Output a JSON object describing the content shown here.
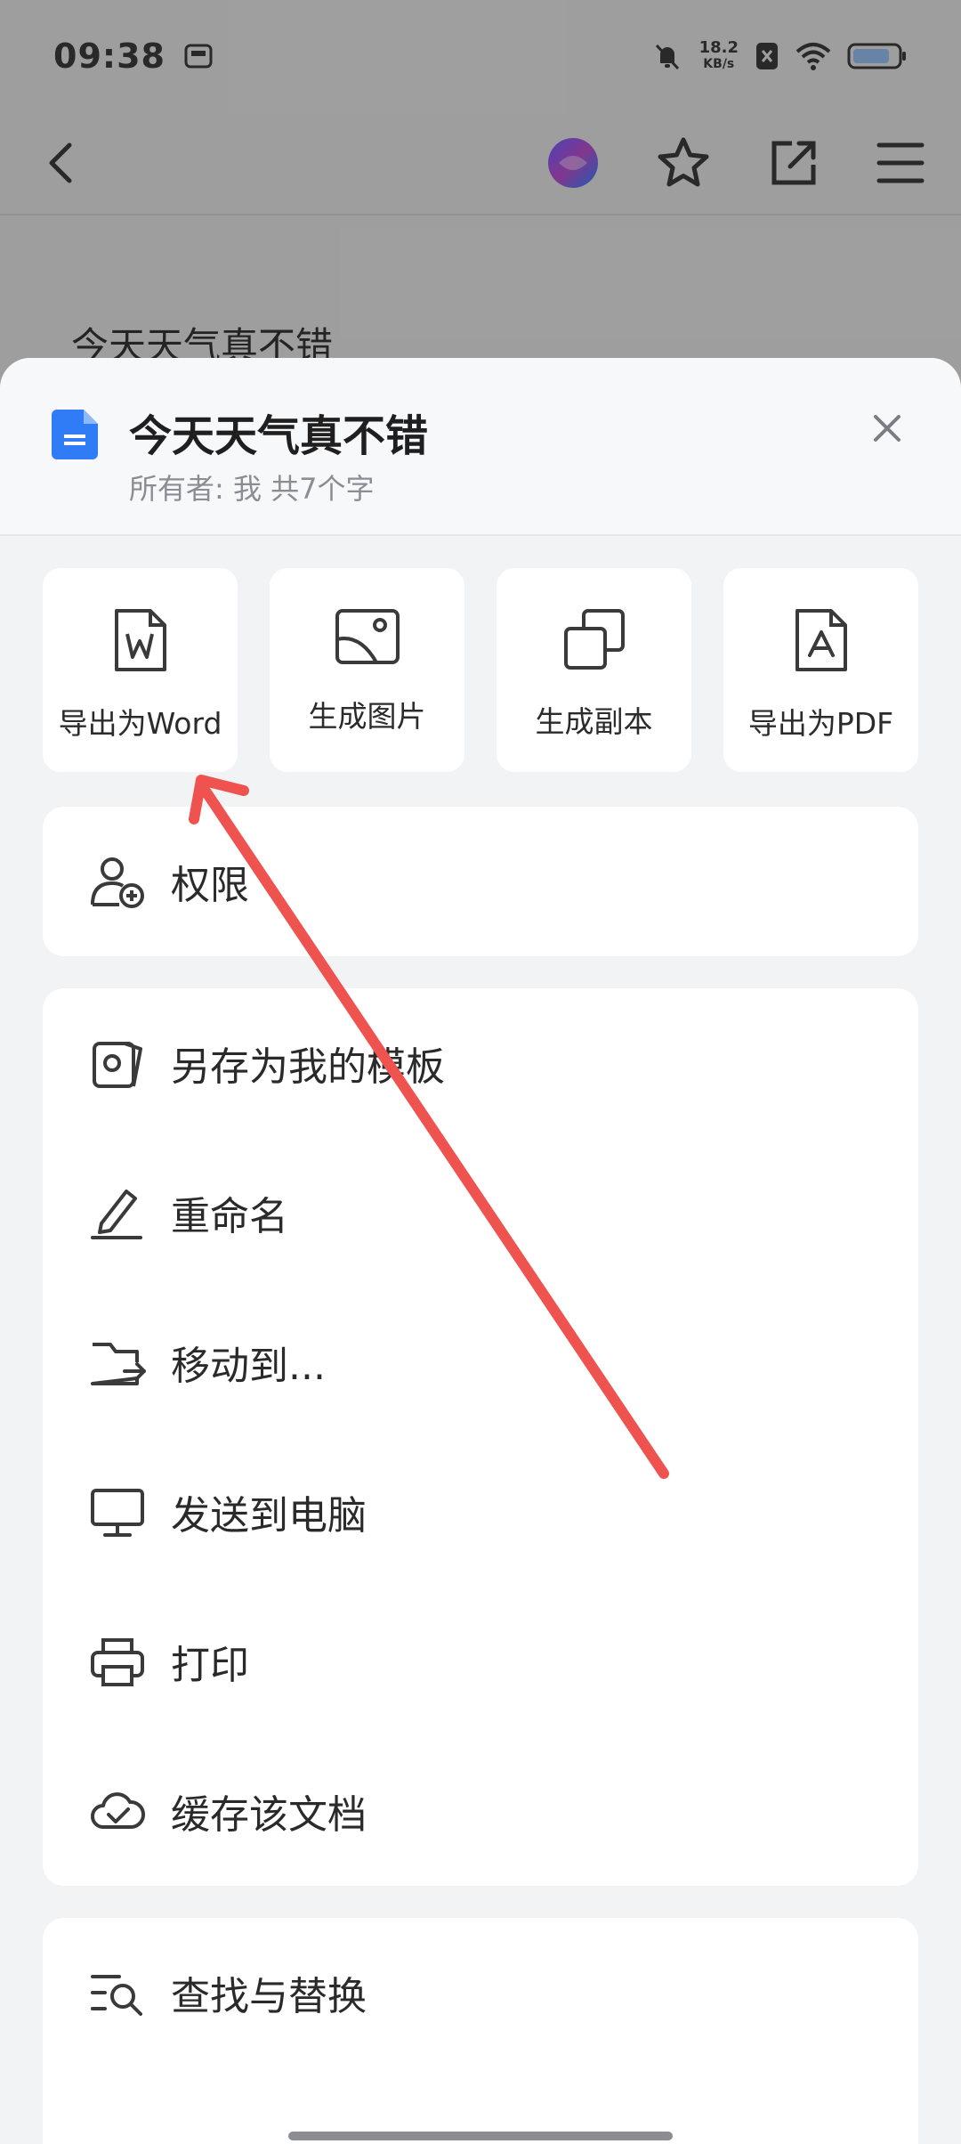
{
  "status": {
    "time": "09:38",
    "speed_top": "18.2",
    "speed_bottom": "KB/s"
  },
  "background_doc": {
    "text": "今天天气真不错"
  },
  "sheet": {
    "title": "今天天气真不错",
    "meta": "所有者: 我   共7个字"
  },
  "actions": [
    {
      "label": "导出为Word",
      "icon": "word-doc-icon"
    },
    {
      "label": "生成图片",
      "icon": "image-icon"
    },
    {
      "label": "生成副本",
      "icon": "copy-icon"
    },
    {
      "label": "导出为PDF",
      "icon": "pdf-icon"
    }
  ],
  "permission": {
    "label": "权限",
    "icon": "user-add-icon"
  },
  "menu": [
    {
      "label": "另存为我的模板",
      "icon": "template-icon"
    },
    {
      "label": "重命名",
      "icon": "pen-icon"
    },
    {
      "label": "移动到...",
      "icon": "folder-move-icon"
    },
    {
      "label": "发送到电脑",
      "icon": "monitor-icon"
    },
    {
      "label": "打印",
      "icon": "printer-icon"
    },
    {
      "label": "缓存该文档",
      "icon": "cloud-check-icon"
    }
  ],
  "search": {
    "label": "查找与替换",
    "icon": "find-replace-icon"
  },
  "colors": {
    "accent": "#2f7cf6",
    "annotation_arrow": "#ef5350"
  }
}
